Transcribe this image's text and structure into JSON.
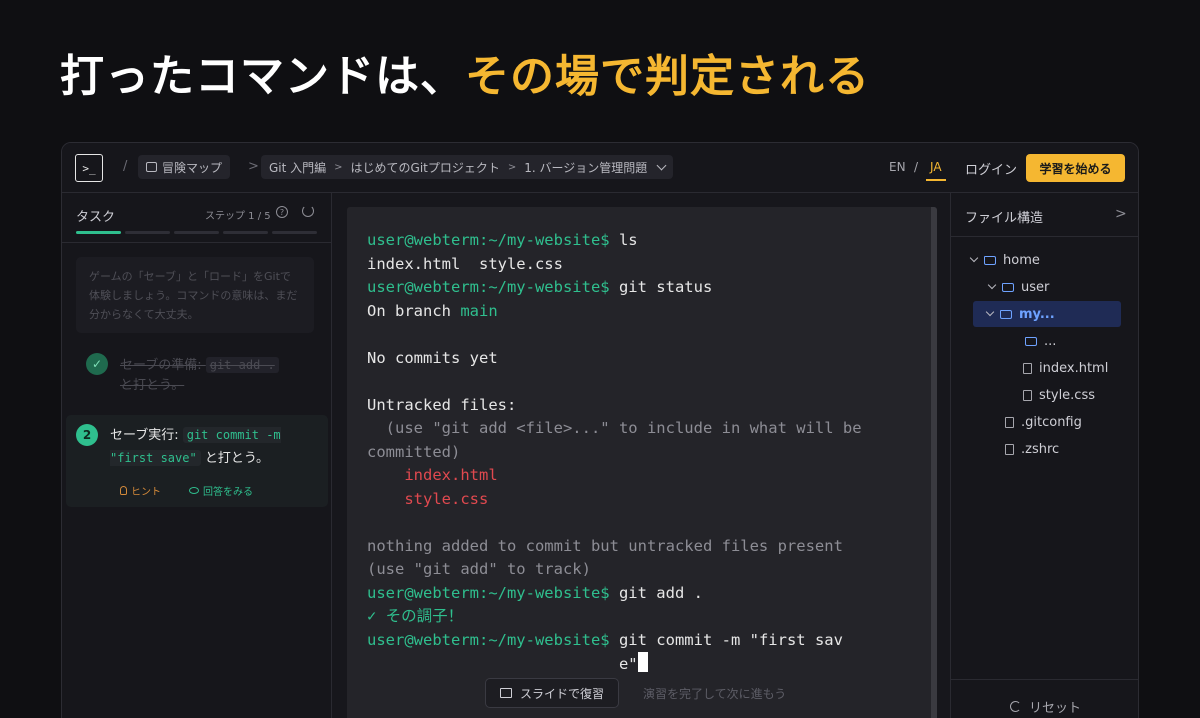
{
  "headline": {
    "white": "打ったコマンドは、",
    "accent": "その場で判定される"
  },
  "topbar": {
    "logo": ">_",
    "breadcrumb_sep": "/",
    "map_label": "冒険マップ",
    "crumbs": [
      "Git 入門編",
      "はじめてのGitプロジェクト",
      "1. バージョン管理問題"
    ],
    "crumb_sep": ">",
    "lang_en": "EN",
    "lang_sep": "/",
    "lang_ja": "JA",
    "login": "ログイン",
    "start": "学習を始める"
  },
  "task_panel": {
    "title": "タスク",
    "step_label": "ステップ 1 / 5",
    "help": "?",
    "progress": {
      "completed": 1,
      "total": 5
    },
    "intro": "ゲームの「セーブ」と「ロード」をGitで体験しましょう。コマンドの意味は、まだ分からなくて大丈夫。",
    "step1": {
      "prefix": "セーブの準備: ",
      "code": "git add .",
      "suffix": "と打とう。",
      "done": true
    },
    "step2": {
      "number": "2",
      "prefix": "セーブ実行: ",
      "code": "git commit -m \"first save\"",
      "suffix": " と打とう。"
    },
    "hint": "ヒント",
    "answer": "回答をみる"
  },
  "terminal": {
    "lines": [
      {
        "prompt": "user@webterm:~/my-website$",
        "text": " ls"
      },
      {
        "text": "index.html  style.css"
      },
      {
        "prompt": "user@webterm:~/my-website$",
        "text": " git status"
      },
      {
        "text": "On branch ",
        "green": "main"
      },
      {
        "text": ""
      },
      {
        "text": "No commits yet"
      },
      {
        "text": ""
      },
      {
        "text": "Untracked files:"
      },
      {
        "dim": "  (use \"git add <file>...\" to include in what will be"
      },
      {
        "dim": "committed)"
      },
      {
        "red": "    index.html"
      },
      {
        "red": "    style.css"
      },
      {
        "text": ""
      },
      {
        "dim": "nothing added to commit but untracked files present"
      },
      {
        "dim": "(use \"git add\" to track)"
      },
      {
        "prompt": "user@webterm:~/my-website$",
        "text": " git add ."
      },
      {
        "green": "✓ その調子！"
      },
      {
        "prompt": "user@webterm:~/my-website$",
        "text": " git commit -m \"first sav"
      },
      {
        "text": "                           e\"",
        "cursor": true
      }
    ],
    "slide_button": "スライドで復習",
    "footer_note": "演習を完了して次に進もう"
  },
  "file_panel": {
    "title": "ファイル構造",
    "tree": [
      {
        "name": "home",
        "type": "folder",
        "depth": 0,
        "expanded": true
      },
      {
        "name": "user",
        "type": "folder",
        "depth": 1,
        "expanded": true
      },
      {
        "name": "my...",
        "type": "folder",
        "depth": 2,
        "expanded": true,
        "selected": true
      },
      {
        "name": "...",
        "type": "folder",
        "depth": 3,
        "expanded": false
      },
      {
        "name": "index.html",
        "type": "file",
        "depth": 3
      },
      {
        "name": "style.css",
        "type": "file",
        "depth": 3
      },
      {
        "name": ".gitconfig",
        "type": "file",
        "depth": 2
      },
      {
        "name": ".zshrc",
        "type": "file",
        "depth": 2
      }
    ],
    "reset": "リセット"
  },
  "colors": {
    "accent": "#f5b731",
    "success": "#2fbf8e",
    "error": "#e0494f",
    "selection": "#6ea2ff"
  }
}
